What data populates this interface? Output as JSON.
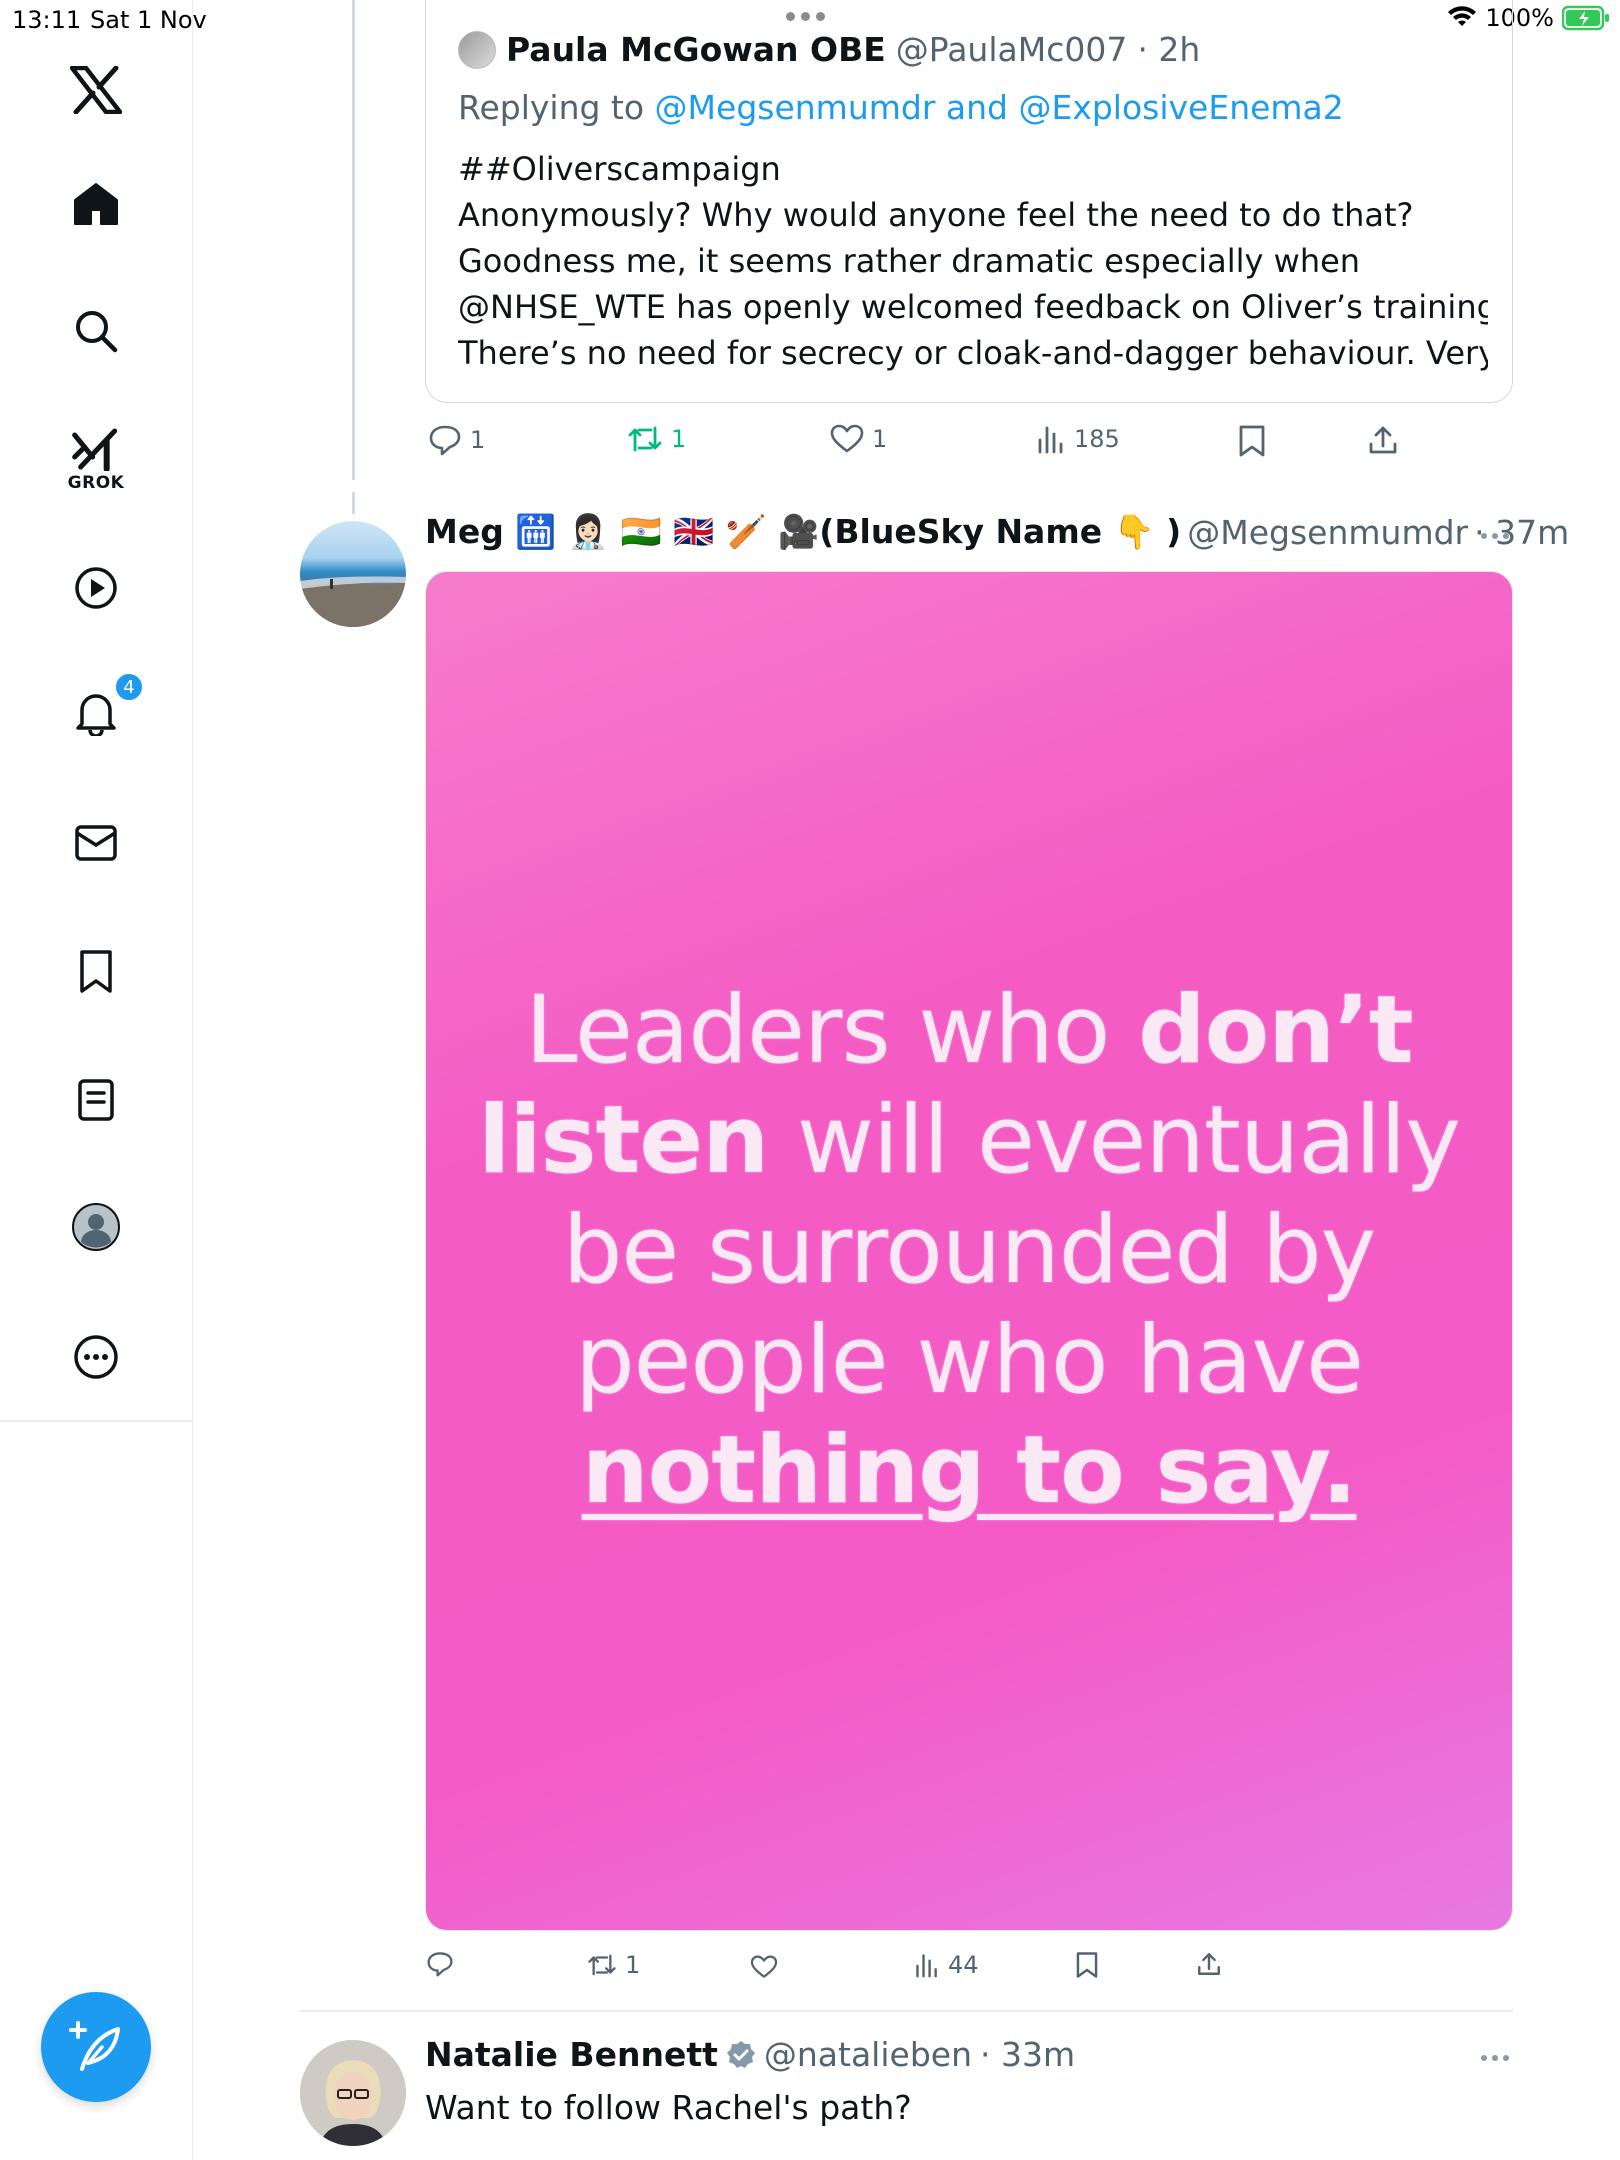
{
  "status_bar": {
    "time": "13:11",
    "date": "Sat 1 Nov",
    "battery": "100%"
  },
  "sidebar": {
    "grok_label": "GROK",
    "notifications_badge": "4"
  },
  "quoted_tweet": {
    "author": "Paula McGowan OBE",
    "handle": "@PaulaMc007",
    "time": "· 2h",
    "replying_prefix": "Replying to",
    "replying_to": "@Megsenmumdr and @ExplosiveEnema2",
    "body_lines": [
      "##Oliverscampaign",
      "Anonymously? Why would anyone feel the need to do that?",
      "Goodness me, it seems rather dramatic especially when",
      "@NHSE_WTE has openly welcomed feedback on Oliver’s training.",
      "There’s no need for secrecy or cloak-and-dagger behaviour. Very…"
    ],
    "stats": {
      "replies": "1",
      "reposts": "1",
      "likes": "1",
      "views": "185"
    }
  },
  "main_tweet": {
    "author": "Meg 🛗 👩🏻‍⚕️ 🇮🇳 🇬🇧 🏏 🎥(BlueSky Name 👇 )",
    "handle": "@Megsenmumdr",
    "time": "· 37m",
    "image_quote": {
      "line1_a": "Leaders who ",
      "line1_b": "don’t",
      "line2_a": "listen",
      "line2_b": " will eventually",
      "line3": "be surrounded by",
      "line4": "people who have",
      "line5": "nothing to say."
    },
    "stats": {
      "replies": "",
      "reposts": "1",
      "likes": "",
      "views": "44"
    }
  },
  "next_tweet": {
    "author": "Natalie Bennett",
    "handle": "@natalieben",
    "time": "· 33m",
    "text": "Want to follow Rachel's path?"
  },
  "colors": {
    "accent": "#1d9bf0",
    "repost_active": "#00ba7c",
    "muted": "#536471"
  }
}
